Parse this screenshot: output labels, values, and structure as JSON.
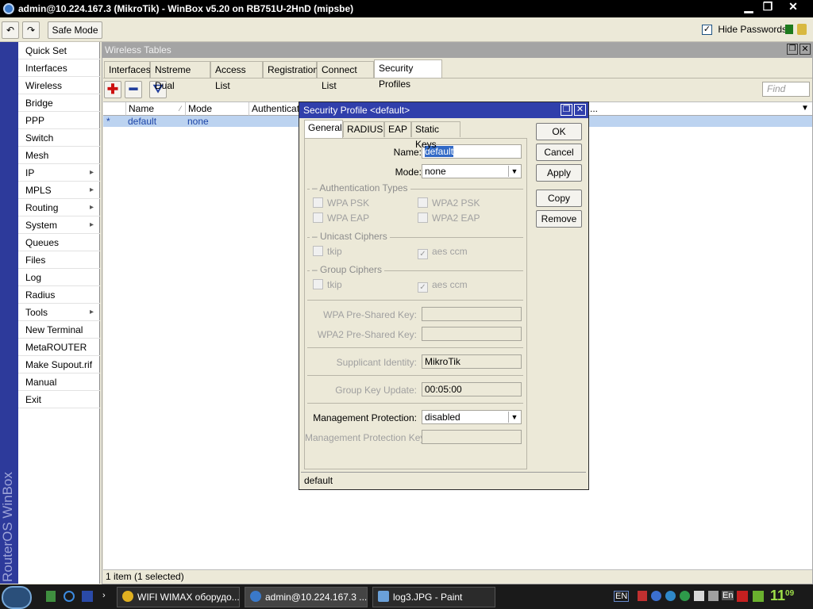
{
  "window": {
    "title": "admin@10.224.167.3 (MikroTik) - WinBox v5.20 on RB751U-2HnD (mipsbe)"
  },
  "toolbar": {
    "safe_mode": "Safe Mode",
    "hide_passwords": "Hide Passwords",
    "hide_passwords_checked": true
  },
  "sidebar": {
    "brand": "RouterOS WinBox",
    "items": [
      {
        "label": "Quick Set",
        "sub": false
      },
      {
        "label": "Interfaces",
        "sub": false
      },
      {
        "label": "Wireless",
        "sub": false
      },
      {
        "label": "Bridge",
        "sub": false
      },
      {
        "label": "PPP",
        "sub": false
      },
      {
        "label": "Switch",
        "sub": false
      },
      {
        "label": "Mesh",
        "sub": false
      },
      {
        "label": "IP",
        "sub": true
      },
      {
        "label": "MPLS",
        "sub": true
      },
      {
        "label": "Routing",
        "sub": true
      },
      {
        "label": "System",
        "sub": true
      },
      {
        "label": "Queues",
        "sub": false
      },
      {
        "label": "Files",
        "sub": false
      },
      {
        "label": "Log",
        "sub": false
      },
      {
        "label": "Radius",
        "sub": false
      },
      {
        "label": "Tools",
        "sub": true
      },
      {
        "label": "New Terminal",
        "sub": false
      },
      {
        "label": "MetaROUTER",
        "sub": false
      },
      {
        "label": "Make Supout.rif",
        "sub": false
      },
      {
        "label": "Manual",
        "sub": false
      },
      {
        "label": "Exit",
        "sub": false
      }
    ]
  },
  "wireless_tables": {
    "title": "Wireless Tables",
    "tabs": [
      "Interfaces",
      "Nstreme Dual",
      "Access List",
      "Registration",
      "Connect List",
      "Security Profiles"
    ],
    "active_tab": "Security Profiles",
    "find_placeholder": "Find",
    "columns": [
      "Name",
      "Mode",
      "Authenticatio",
      "..."
    ],
    "rows": [
      {
        "marker": "*",
        "name": "default",
        "mode": "none"
      }
    ],
    "status": "1 item (1 selected)"
  },
  "dialog": {
    "title": "Security Profile <default>",
    "tabs": [
      "General",
      "RADIUS",
      "EAP",
      "Static Keys"
    ],
    "active_tab": "General",
    "name_label": "Name:",
    "name_value": "default",
    "mode_label": "Mode:",
    "mode_value": "none",
    "auth_types_title": "Authentication Types",
    "auth_types": [
      "WPA PSK",
      "WPA2 PSK",
      "WPA EAP",
      "WPA2 EAP"
    ],
    "unicast_title": "Unicast Ciphers",
    "unicast": [
      "tkip",
      "aes ccm"
    ],
    "group_title": "Group Ciphers",
    "group": [
      "tkip",
      "aes ccm"
    ],
    "wpa_psk_label": "WPA Pre-Shared Key:",
    "wpa2_psk_label": "WPA2 Pre-Shared Key:",
    "supplicant_label": "Supplicant Identity:",
    "supplicant_value": "MikroTik",
    "group_key_label": "Group Key Update:",
    "group_key_value": "00:05:00",
    "mgmt_prot_label": "Management Protection:",
    "mgmt_prot_value": "disabled",
    "mgmt_key_label": "Management Protection Key:",
    "buttons": {
      "ok": "OK",
      "cancel": "Cancel",
      "apply": "Apply",
      "copy": "Copy",
      "remove": "Remove"
    },
    "status": "default"
  },
  "taskbar": {
    "tasks": [
      "WIFI WIMAX оборудо...",
      "admin@10.224.167.3 ...",
      "log3.JPG - Paint"
    ],
    "lang": "EN",
    "lang2": "En",
    "clock_hour": "11",
    "clock_min": "09"
  }
}
